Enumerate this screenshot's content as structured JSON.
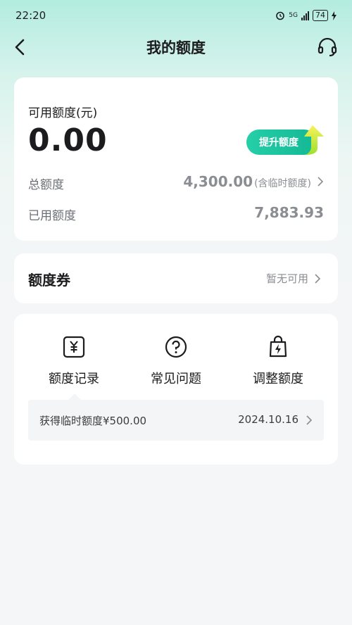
{
  "status_bar": {
    "time": "22:20",
    "network": "5G",
    "battery": "74"
  },
  "nav": {
    "title": "我的额度",
    "back_icon": "chevron-left-icon",
    "service_icon": "headset-icon"
  },
  "quota": {
    "available_label": "可用额度(元)",
    "available_value": "0.00",
    "raise_button": "提升额度",
    "total_label": "总额度",
    "total_value": "4,300.00",
    "total_note": "(含临时额度)",
    "used_label": "已用额度",
    "used_value": "7,883.93"
  },
  "coupon": {
    "title": "额度券",
    "status": "暂无可用"
  },
  "menu": {
    "items": [
      {
        "label": "额度记录",
        "icon": "yen-receipt-icon"
      },
      {
        "label": "常见问题",
        "icon": "question-circle-icon"
      },
      {
        "label": "调整额度",
        "icon": "lightning-bag-icon"
      }
    ]
  },
  "record": {
    "text": "获得临时额度¥500.00",
    "date": "2024.10.16"
  },
  "colors": {
    "accent": "#13b894",
    "header_gradient_top": "#b3ece0",
    "background": "#f4f6f7"
  }
}
